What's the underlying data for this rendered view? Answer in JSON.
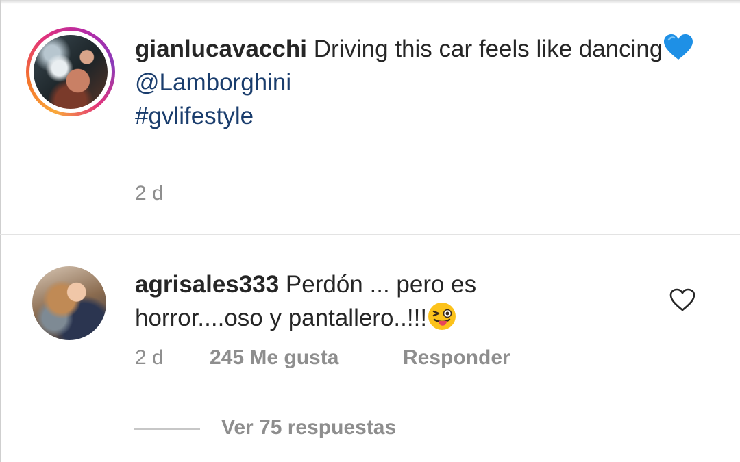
{
  "caption": {
    "username": "gianlucavacchi",
    "text": "Driving this car feels like dancing",
    "emoji": "blue-heart-icon",
    "mention": "@Lamborghini",
    "hashtag": "#gvlifestyle",
    "time": "2 d"
  },
  "comment": {
    "username": "agrisales333",
    "text": "Perdón ... pero es horror....oso y pantallero..!!!",
    "emoji": "winking-tongue-face-icon",
    "time": "2 d",
    "likes": "245 Me gusta",
    "reply_label": "Responder",
    "view_replies": "Ver 75 respuestas"
  },
  "colors": {
    "link": "#1a3d6d",
    "muted": "#8e8e8e",
    "text": "#262626",
    "emoji_heart": "#1e90e6"
  }
}
